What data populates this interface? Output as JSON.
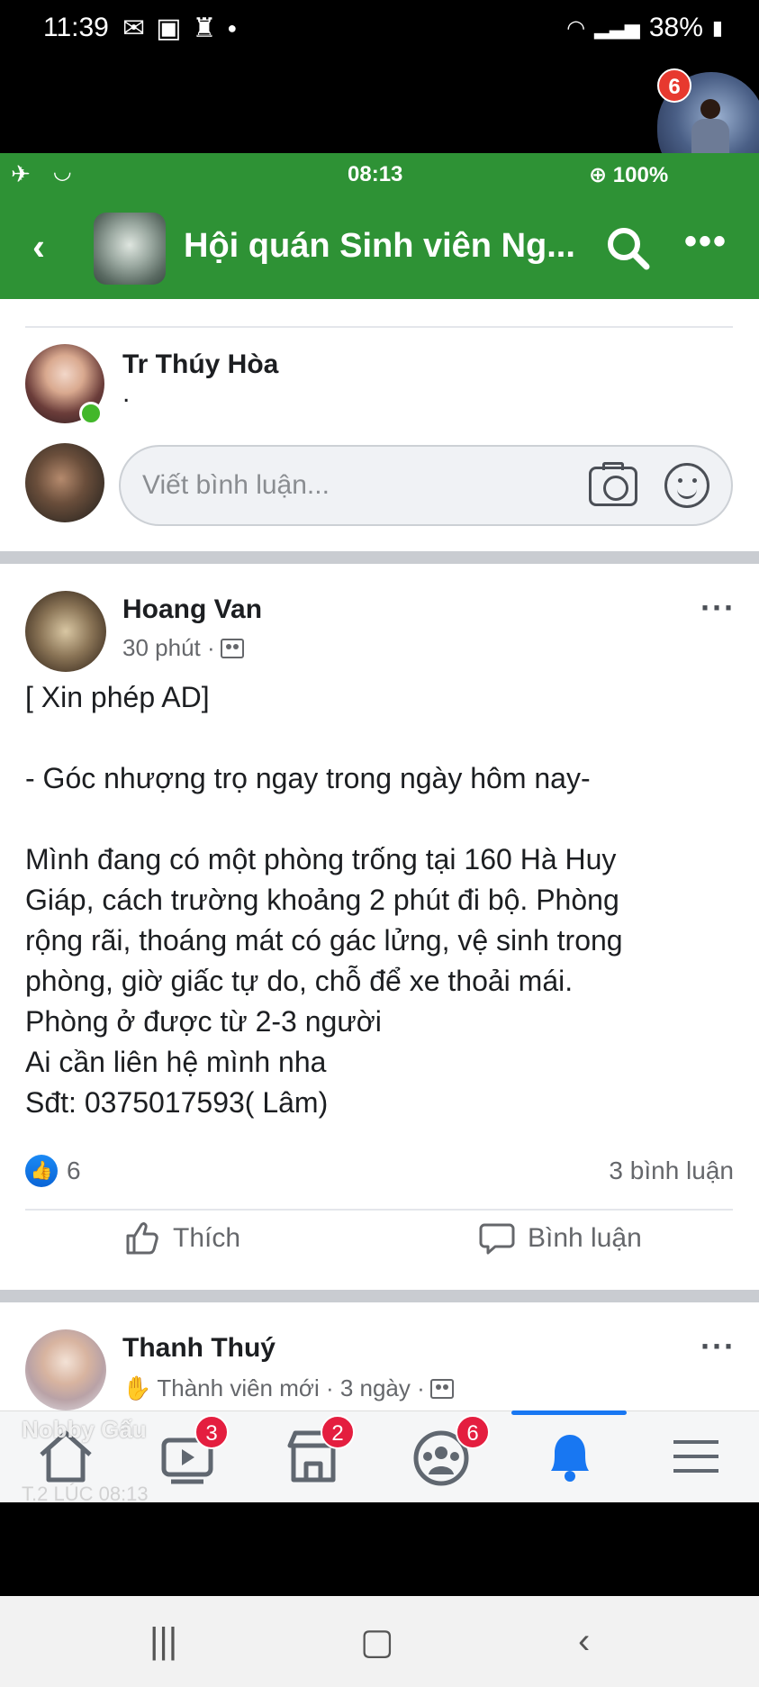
{
  "outer_status": {
    "time": "11:39",
    "battery": "38%"
  },
  "chat_head": {
    "badge": "6"
  },
  "inner_status": {
    "time": "08:13",
    "battery": "100%"
  },
  "header": {
    "title": "Hội quán Sinh viên Ng..."
  },
  "comment": {
    "author": "Tr Thúy Hòa",
    "text": "."
  },
  "comment_input": {
    "placeholder": "Viết bình luận..."
  },
  "post": {
    "author": "Hoang Van",
    "time": "30 phút ·",
    "lines": [
      "[ Xin phép AD]",
      "",
      "- Góc nhượng trọ ngay trong ngày hôm nay-",
      "",
      "Mình đang có một phòng trống tại 160 Hà Huy",
      "Giáp, cách trường khoảng 2 phút đi bộ. Phòng",
      "rộng rãi, thoáng mát có gác lửng, vệ sinh trong",
      "phòng, giờ giấc tự do, chỗ để xe thoải mái.",
      "Phòng ở được từ 2-3 người",
      "Ai cần liên hệ mình nha",
      "Sđt: 0375017593( Lâm)"
    ],
    "likes": "6",
    "comments": "3 bình luận",
    "like_label": "Thích",
    "comment_label": "Bình luận"
  },
  "next_post": {
    "author": "Thanh Thuý",
    "meta": "Thành viên mới · 3 ngày ·"
  },
  "bottom_nav": {
    "items": [
      {
        "name": "home",
        "icon": "home-icon",
        "badge": ""
      },
      {
        "name": "watch",
        "icon": "video-icon",
        "badge": "3"
      },
      {
        "name": "marketplace",
        "icon": "store-icon",
        "badge": "2"
      },
      {
        "name": "groups",
        "icon": "groups-icon",
        "badge": "6"
      },
      {
        "name": "notifications",
        "icon": "bell-icon",
        "badge": ""
      },
      {
        "name": "menu",
        "icon": "menu-icon",
        "badge": ""
      }
    ]
  },
  "overlay": {
    "name": "Nobby Gấu",
    "time": "T.2 LÚC 08:13"
  },
  "colors": {
    "fb_green": "#2e9235",
    "fb_blue": "#1877f2",
    "badge_red": "#e41e3f"
  }
}
